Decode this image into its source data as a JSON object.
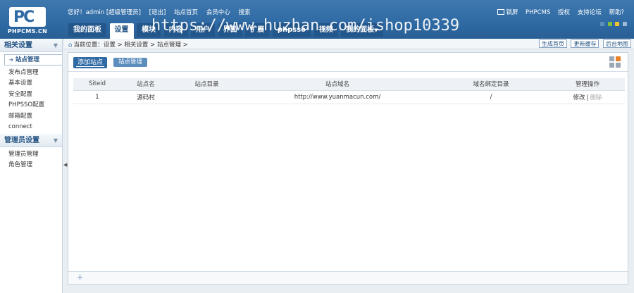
{
  "logo": {
    "mark": "PC",
    "text": "PHPCMS.CN"
  },
  "top": {
    "greeting": "您好！admin [超级管理员]",
    "logout": "[退出]",
    "site_home": "站点首页",
    "member_center": "会员中心",
    "search": "搜索"
  },
  "top_right": {
    "lock_screen": "锁屏",
    "phpcms": "PHPCMS",
    "license": "授权",
    "support": "支持论坛",
    "help": "帮助？"
  },
  "theme_colors": [
    "#5b8dbd",
    "#7fbf3f",
    "#f1c232",
    "#9bb8d6"
  ],
  "nav": {
    "tabs": [
      {
        "label": "我的面板",
        "active": false
      },
      {
        "label": "设置",
        "active": true
      },
      {
        "label": "模块",
        "active": false
      },
      {
        "label": "内容",
        "active": false
      },
      {
        "label": "用户",
        "active": false
      },
      {
        "label": "界面",
        "active": false
      },
      {
        "label": "扩展",
        "active": false
      },
      {
        "label": "phpsso",
        "active": false
      },
      {
        "label": "视频",
        "active": false
      },
      {
        "label": "我的面板",
        "active": false
      }
    ]
  },
  "watermark": "https://www.huzhan.com/ishop10339",
  "sidebar": {
    "section1": "相关设置",
    "items1": [
      "站点管理",
      "发布点管理",
      "基本设置",
      "安全配置",
      "PHPSSO配置",
      "邮箱配置",
      "connect"
    ],
    "section2": "管理员设置",
    "items2": [
      "管理员管理",
      "角色管理"
    ]
  },
  "crumb": {
    "text": "当前位置：设置 > 相关设置 > 站点管理 >",
    "buttons": [
      "生成首页",
      "更新缓存",
      "后台地图"
    ]
  },
  "toolbar": {
    "add": "添加站点",
    "manage": "站点管理"
  },
  "table": {
    "headers": [
      "Siteid",
      "站点名",
      "站点目录",
      "站点域名",
      "域名绑定目录",
      "管理操作"
    ],
    "rows": [
      {
        "siteid": "1",
        "name": "源码村",
        "dir": "",
        "domain": "http://www.yuanmacun.com/",
        "bind_dir": "/",
        "edit": "修改",
        "delete": "删除"
      }
    ]
  },
  "footer": {
    "plus": "+"
  }
}
